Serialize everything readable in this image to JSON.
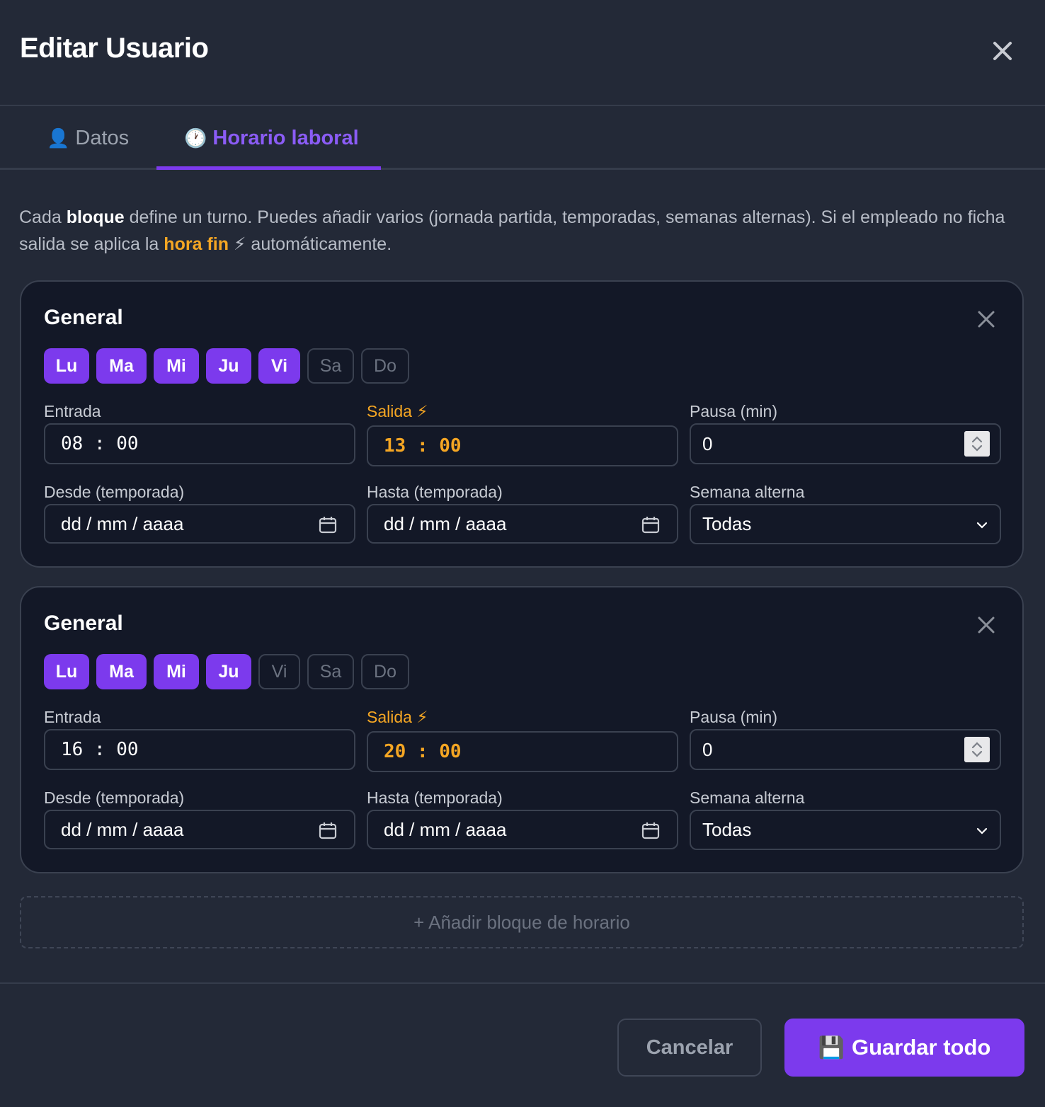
{
  "modal": {
    "title": "Editar Usuario",
    "close_icon": "close-icon"
  },
  "tabs": [
    {
      "label": "Datos",
      "icon": "👤",
      "active": false
    },
    {
      "label": "Horario laboral",
      "icon": "🕐",
      "active": true
    }
  ],
  "intro": {
    "part1": "Cada ",
    "bold1": "bloque",
    "part2": " define un turno. Puedes añadir varios (jornada partida, temporadas, semanas alternas). Si el empleado no ficha salida se aplica la ",
    "highlight": "hora fin",
    "bolt": "⚡",
    "part3": " automáticamente."
  },
  "labels": {
    "entrada": "Entrada",
    "salida": "Salida",
    "salida_icon": "⚡",
    "pausa": "Pausa (min)",
    "desde": "Desde (temporada)",
    "hasta": "Hasta (temporada)",
    "semana": "Semana alterna",
    "date_placeholder": "dd / mm / aaaa"
  },
  "blocks": [
    {
      "title": "General",
      "days": [
        {
          "label": "Lu",
          "on": true
        },
        {
          "label": "Ma",
          "on": true
        },
        {
          "label": "Mi",
          "on": true
        },
        {
          "label": "Ju",
          "on": true
        },
        {
          "label": "Vi",
          "on": true
        },
        {
          "label": "Sa",
          "on": false
        },
        {
          "label": "Do",
          "on": false
        }
      ],
      "entrada": "08 : 00",
      "salida": "13 : 00",
      "pausa": "0",
      "desde": "dd / mm / aaaa",
      "hasta": "dd / mm / aaaa",
      "semana": "Todas"
    },
    {
      "title": "General",
      "days": [
        {
          "label": "Lu",
          "on": true
        },
        {
          "label": "Ma",
          "on": true
        },
        {
          "label": "Mi",
          "on": true
        },
        {
          "label": "Ju",
          "on": true
        },
        {
          "label": "Vi",
          "on": false
        },
        {
          "label": "Sa",
          "on": false
        },
        {
          "label": "Do",
          "on": false
        }
      ],
      "entrada": "16 : 00",
      "salida": "20 : 00",
      "pausa": "0",
      "desde": "dd / mm / aaaa",
      "hasta": "dd / mm / aaaa",
      "semana": "Todas"
    }
  ],
  "add_block_label": "+ Añadir bloque de horario",
  "footer": {
    "cancel_label": "Cancelar",
    "save_icon": "💾",
    "save_label": "Guardar todo"
  },
  "colors": {
    "background": "#232937",
    "card": "#131827",
    "accent": "#7c3aed",
    "accent_text": "#8b5cf6",
    "orange": "#f5a623"
  }
}
